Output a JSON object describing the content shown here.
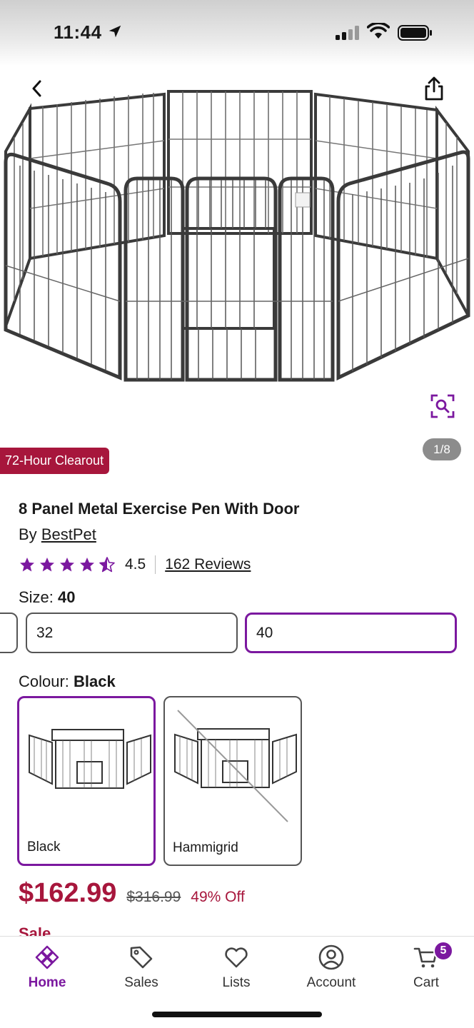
{
  "status": {
    "time": "11:44"
  },
  "gallery": {
    "counter": "1/8"
  },
  "badge": {
    "clearout": "72-Hour Clearout"
  },
  "product": {
    "title": "8 Panel Metal Exercise Pen With Door",
    "by_prefix": "By",
    "brand": "BestPet",
    "rating": "4.5",
    "rating_value": 4.5,
    "reviews": "162 Reviews"
  },
  "size": {
    "label": "Size:",
    "selected": "40",
    "options": [
      "32",
      "40"
    ]
  },
  "colour": {
    "label": "Colour:",
    "selected": "Black",
    "options": [
      "Black",
      "Hammigrid"
    ]
  },
  "pricing": {
    "price": "$162.99",
    "was": "$316.99",
    "off": "49% Off",
    "sale": "Sale"
  },
  "tabbar": {
    "home": "Home",
    "sales": "Sales",
    "lists": "Lists",
    "account": "Account",
    "cart": "Cart",
    "cart_count": "5"
  },
  "colors": {
    "accent": "#7b189f",
    "sale_red": "#a7163c"
  }
}
